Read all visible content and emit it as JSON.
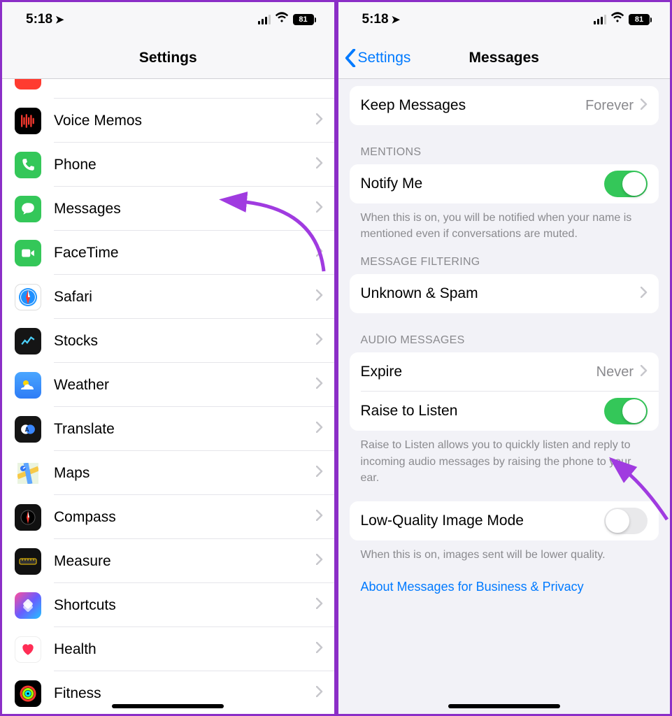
{
  "status": {
    "time": "5:18",
    "battery": "81"
  },
  "left": {
    "title": "Settings",
    "items": [
      {
        "label": "Voice Memos",
        "icon": "voicememos"
      },
      {
        "label": "Phone",
        "icon": "phone"
      },
      {
        "label": "Messages",
        "icon": "messages"
      },
      {
        "label": "FaceTime",
        "icon": "facetime"
      },
      {
        "label": "Safari",
        "icon": "safari"
      },
      {
        "label": "Stocks",
        "icon": "stocks"
      },
      {
        "label": "Weather",
        "icon": "weather"
      },
      {
        "label": "Translate",
        "icon": "translate"
      },
      {
        "label": "Maps",
        "icon": "maps"
      },
      {
        "label": "Compass",
        "icon": "compass"
      },
      {
        "label": "Measure",
        "icon": "measure"
      },
      {
        "label": "Shortcuts",
        "icon": "shortcuts"
      },
      {
        "label": "Health",
        "icon": "health"
      },
      {
        "label": "Fitness",
        "icon": "fitness"
      }
    ]
  },
  "right": {
    "back": "Settings",
    "title": "Messages",
    "keepMessages": {
      "label": "Keep Messages",
      "value": "Forever"
    },
    "sections": {
      "mentions": {
        "header": "MENTIONS",
        "notify": {
          "label": "Notify Me",
          "on": true
        },
        "footer": "When this is on, you will be notified when your name is mentioned even if conversations are muted."
      },
      "filtering": {
        "header": "MESSAGE FILTERING",
        "unknown": {
          "label": "Unknown & Spam"
        }
      },
      "audio": {
        "header": "AUDIO MESSAGES",
        "expire": {
          "label": "Expire",
          "value": "Never"
        },
        "raise": {
          "label": "Raise to Listen",
          "on": true
        },
        "footer": "Raise to Listen allows you to quickly listen and reply to incoming audio messages by raising the phone to your ear."
      },
      "lowquality": {
        "label": "Low-Quality Image Mode",
        "on": false,
        "footer": "When this is on, images sent will be lower quality."
      }
    },
    "link": "About Messages for Business & Privacy"
  },
  "colors": {
    "accent": "#007aff",
    "toggleOn": "#34c759",
    "annotation": "#a03be0"
  }
}
